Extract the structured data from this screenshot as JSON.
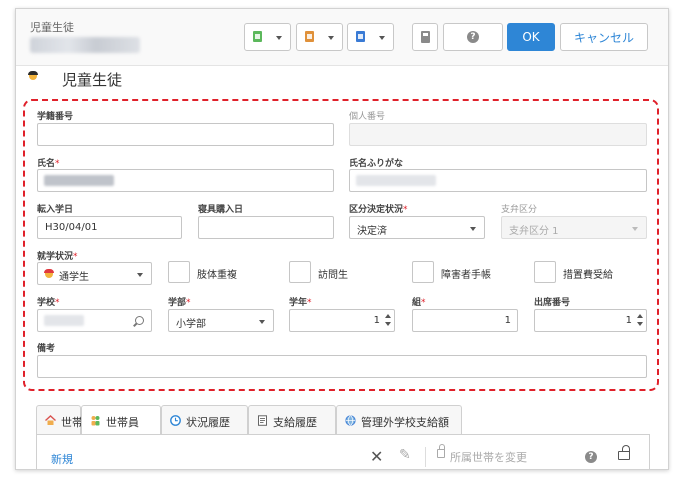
{
  "window": {
    "title": "児童生徒"
  },
  "toolbar": {
    "ok_label": "OK",
    "cancel_label": "キャンセル",
    "colors": {
      "green": "#5cb85c",
      "orange": "#e0913a",
      "blue": "#3a7bd5",
      "ok_bg": "#2e86d6"
    }
  },
  "page": {
    "title": "児童生徒"
  },
  "form": {
    "gakuseki_no": {
      "label": "学籍番号",
      "value": ""
    },
    "kojin_no": {
      "label": "個人番号",
      "value": ""
    },
    "shimei": {
      "label": "氏名",
      "required": "*"
    },
    "shimei_kana": {
      "label": "氏名ふりがな"
    },
    "tennyu_date": {
      "label": "転入学日",
      "value": "H30/04/01"
    },
    "shingu_date": {
      "label": "寝具購入日",
      "value": ""
    },
    "kubun_status": {
      "label": "区分決定状況",
      "required": "*",
      "value": "決定済"
    },
    "shiben_kubun": {
      "label": "支弁区分",
      "value": "支弁区分 1"
    },
    "shugaku_status": {
      "label": "就学状況",
      "required": "*",
      "value": "通学生"
    },
    "checkboxes": [
      {
        "label": "肢体重複"
      },
      {
        "label": "訪問生"
      },
      {
        "label": "障害者手帳"
      },
      {
        "label": "措置費受給"
      }
    ],
    "school": {
      "label": "学校",
      "required": "*"
    },
    "gakubu": {
      "label": "学部",
      "required": "*",
      "value": "小学部"
    },
    "grade": {
      "label": "学年",
      "required": "*",
      "value": "1"
    },
    "kumi": {
      "label": "組",
      "required": "*",
      "value": "1"
    },
    "shusseki_no": {
      "label": "出席番号",
      "value": "1"
    },
    "biko": {
      "label": "備考",
      "value": ""
    }
  },
  "tabs": [
    {
      "label": "世帯",
      "icon": "house-icon"
    },
    {
      "label": "世帯員",
      "icon": "people-icon"
    },
    {
      "label": "状況履歴",
      "icon": "clock-icon"
    },
    {
      "label": "支給履歴",
      "icon": "document-icon"
    },
    {
      "label": "管理外学校支給額",
      "icon": "globe-icon"
    }
  ],
  "subpanel": {
    "new_label": "新規",
    "move_label": "所属世帯を変更"
  }
}
